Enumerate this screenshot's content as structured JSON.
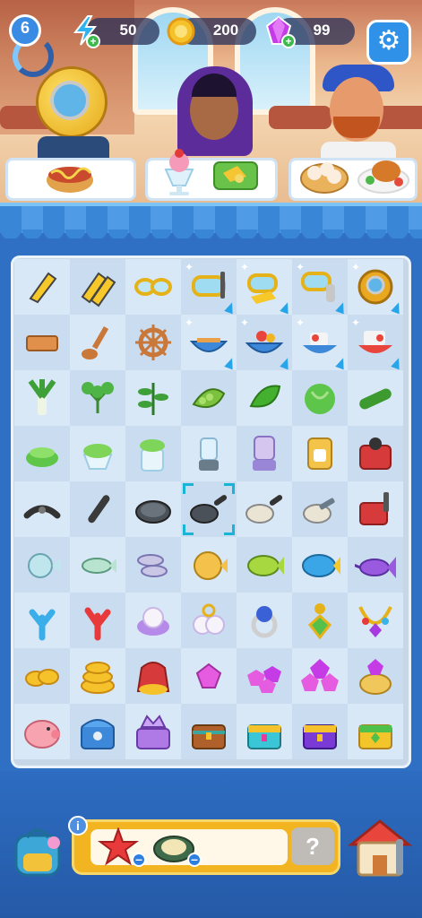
{
  "hud": {
    "level": "6",
    "energy": "50",
    "coins": "200",
    "gems": "99"
  },
  "customers": [
    {
      "name": "diver",
      "order": [
        "hotdog"
      ]
    },
    {
      "name": "princess",
      "order": [
        "sundae",
        "cheese-plate"
      ]
    },
    {
      "name": "chef",
      "order": [
        "dumplings",
        "roast-plate"
      ]
    }
  ],
  "board": {
    "rows": [
      [
        {
          "icon": "flipper"
        },
        {
          "icon": "flippers-pair"
        },
        {
          "icon": "goggles"
        },
        {
          "icon": "snorkel-mask",
          "sparkle": true,
          "bolt": true
        },
        {
          "icon": "snorkel-set",
          "sparkle": true,
          "bolt": true
        },
        {
          "icon": "snorkel-gear",
          "sparkle": true,
          "bolt": true
        },
        {
          "icon": "diving-helmet",
          "sparkle": true,
          "bolt": true
        }
      ],
      [
        {
          "icon": "plank"
        },
        {
          "icon": "oars"
        },
        {
          "icon": "ship-wheel"
        },
        {
          "icon": "rowboat",
          "sparkle": true,
          "bolt": true
        },
        {
          "icon": "rowboat-crew",
          "sparkle": true,
          "bolt": true
        },
        {
          "icon": "motorboat",
          "sparkle": true,
          "bolt": true
        },
        {
          "icon": "red-boat",
          "sparkle": true,
          "bolt": true
        }
      ],
      [
        {
          "icon": "leek"
        },
        {
          "icon": "parsley"
        },
        {
          "icon": "herb"
        },
        {
          "icon": "peas"
        },
        {
          "icon": "pepper"
        },
        {
          "icon": "lettuce"
        },
        {
          "icon": "cucumber"
        }
      ],
      [
        {
          "icon": "juicer-small"
        },
        {
          "icon": "juicer"
        },
        {
          "icon": "juicer-jug"
        },
        {
          "icon": "blender-small"
        },
        {
          "icon": "blender"
        },
        {
          "icon": "coffee-maker"
        },
        {
          "icon": "kitchen-robot"
        }
      ],
      [
        {
          "icon": "pan-handle"
        },
        {
          "icon": "handle"
        },
        {
          "icon": "pot-lid"
        },
        {
          "icon": "frying-pan",
          "selected": true
        },
        {
          "icon": "skillet"
        },
        {
          "icon": "pan-spatula"
        },
        {
          "icon": "stove"
        }
      ],
      [
        {
          "icon": "blowfish-small"
        },
        {
          "icon": "sardine"
        },
        {
          "icon": "fish-pair"
        },
        {
          "icon": "pufferfish"
        },
        {
          "icon": "green-fish"
        },
        {
          "icon": "tuna"
        },
        {
          "icon": "marlin"
        }
      ],
      [
        {
          "icon": "coral-blue"
        },
        {
          "icon": "coral-red"
        },
        {
          "icon": "pearl"
        },
        {
          "icon": "pearls"
        },
        {
          "icon": "pearl-ring"
        },
        {
          "icon": "emerald-earring"
        },
        {
          "icon": "gem-necklace"
        }
      ],
      [
        {
          "icon": "coins-small"
        },
        {
          "icon": "coin-stack"
        },
        {
          "icon": "coin-sack"
        },
        {
          "icon": "gem-small"
        },
        {
          "icon": "gems"
        },
        {
          "icon": "gem-pile"
        },
        {
          "icon": "gem-pot"
        }
      ],
      [
        {
          "icon": "piggy-bank"
        },
        {
          "icon": "blue-chest"
        },
        {
          "icon": "crown-chest"
        },
        {
          "icon": "wooden-chest"
        },
        {
          "icon": "teal-chest"
        },
        {
          "icon": "purple-chest"
        },
        {
          "icon": "gold-chest"
        }
      ]
    ]
  },
  "storage": {
    "items": [
      "starfish",
      "clam"
    ],
    "mystery": "?"
  },
  "colors": {
    "background": "#2f6fc4",
    "board": "#c7d7e8",
    "storage": "#f2b521",
    "accent": "#17b6d6"
  }
}
